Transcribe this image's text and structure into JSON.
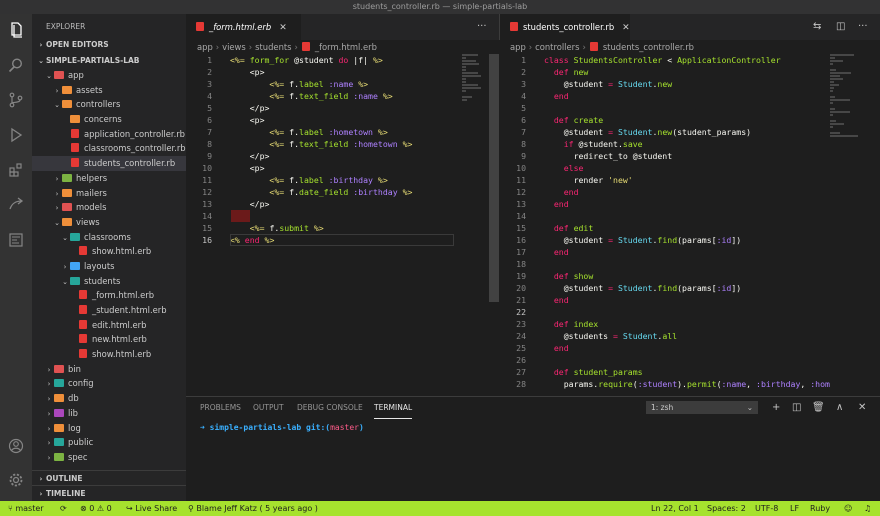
{
  "window": {
    "title": "students_controller.rb — simple-partials-lab"
  },
  "activity_bar": [
    "files-icon",
    "search-icon",
    "source-control-icon",
    "run-debug-icon",
    "extensions-icon",
    "remote-icon",
    "preview-icon",
    "account-icon",
    "settings-gear-icon"
  ],
  "sidebar": {
    "title": "EXPLORER",
    "open_editors": "OPEN EDITORS",
    "project": "SIMPLE-PARTIALS-LAB",
    "tree": [
      {
        "label": "app",
        "depth": 1,
        "type": "folder",
        "color": "red",
        "open": true
      },
      {
        "label": "assets",
        "depth": 2,
        "type": "folder",
        "color": "orange",
        "open": false
      },
      {
        "label": "controllers",
        "depth": 2,
        "type": "folder",
        "color": "orange",
        "open": true
      },
      {
        "label": "concerns",
        "depth": 3,
        "type": "folder",
        "color": "orange",
        "open": false,
        "nochev": true
      },
      {
        "label": "application_controller.rb",
        "depth": 3,
        "type": "file"
      },
      {
        "label": "classrooms_controller.rb",
        "depth": 3,
        "type": "file"
      },
      {
        "label": "students_controller.rb",
        "depth": 3,
        "type": "file",
        "selected": true
      },
      {
        "label": "helpers",
        "depth": 2,
        "type": "folder",
        "color": "green",
        "open": false
      },
      {
        "label": "mailers",
        "depth": 2,
        "type": "folder",
        "color": "orange",
        "open": false
      },
      {
        "label": "models",
        "depth": 2,
        "type": "folder",
        "color": "red",
        "open": false
      },
      {
        "label": "views",
        "depth": 2,
        "type": "folder",
        "color": "orange",
        "open": true
      },
      {
        "label": "classrooms",
        "depth": 3,
        "type": "folder",
        "color": "teal",
        "open": true
      },
      {
        "label": "show.html.erb",
        "depth": 4,
        "type": "file"
      },
      {
        "label": "layouts",
        "depth": 3,
        "type": "folder",
        "color": "blue",
        "open": false
      },
      {
        "label": "students",
        "depth": 3,
        "type": "folder",
        "color": "teal",
        "open": true
      },
      {
        "label": "_form.html.erb",
        "depth": 4,
        "type": "file"
      },
      {
        "label": "_student.html.erb",
        "depth": 4,
        "type": "file"
      },
      {
        "label": "edit.html.erb",
        "depth": 4,
        "type": "file"
      },
      {
        "label": "new.html.erb",
        "depth": 4,
        "type": "file"
      },
      {
        "label": "show.html.erb",
        "depth": 4,
        "type": "file"
      },
      {
        "label": "bin",
        "depth": 1,
        "type": "folder",
        "color": "red",
        "open": false
      },
      {
        "label": "config",
        "depth": 1,
        "type": "folder",
        "color": "teal",
        "open": false
      },
      {
        "label": "db",
        "depth": 1,
        "type": "folder",
        "color": "orange",
        "open": false
      },
      {
        "label": "lib",
        "depth": 1,
        "type": "folder",
        "color": "purple",
        "open": false
      },
      {
        "label": "log",
        "depth": 1,
        "type": "folder",
        "color": "orange",
        "open": false
      },
      {
        "label": "public",
        "depth": 1,
        "type": "folder",
        "color": "teal",
        "open": false
      },
      {
        "label": "spec",
        "depth": 1,
        "type": "folder",
        "color": "green",
        "open": false
      }
    ],
    "outline": "OUTLINE",
    "timeline": "TIMELINE"
  },
  "left_editor": {
    "tab": "_form.html.erb",
    "breadcrumb": [
      "app",
      "views",
      "students",
      "_form.html.erb"
    ],
    "lines": [
      [
        [
          "<%= ",
          "erb"
        ],
        [
          "form_for ",
          "fn"
        ],
        [
          "@student ",
          "id"
        ],
        [
          "do ",
          "kw"
        ],
        [
          "|f| ",
          "id"
        ],
        [
          "%>",
          "erb"
        ]
      ],
      [
        [
          "    <p>",
          "tag"
        ]
      ],
      [
        [
          "        <%= ",
          "erb"
        ],
        [
          "f",
          "id"
        ],
        [
          ".",
          "id"
        ],
        [
          "label ",
          "fn"
        ],
        [
          ":name ",
          "sym"
        ],
        [
          "%>",
          "erb"
        ]
      ],
      [
        [
          "        <%= ",
          "erb"
        ],
        [
          "f",
          "id"
        ],
        [
          ".",
          "id"
        ],
        [
          "text_field ",
          "fn"
        ],
        [
          ":name ",
          "sym"
        ],
        [
          "%>",
          "erb"
        ]
      ],
      [
        [
          "    </p>",
          "tag"
        ]
      ],
      [
        [
          "    <p>",
          "tag"
        ]
      ],
      [
        [
          "        <%= ",
          "erb"
        ],
        [
          "f",
          "id"
        ],
        [
          ".",
          "id"
        ],
        [
          "label ",
          "fn"
        ],
        [
          ":hometown ",
          "sym"
        ],
        [
          "%>",
          "erb"
        ]
      ],
      [
        [
          "        <%= ",
          "erb"
        ],
        [
          "f",
          "id"
        ],
        [
          ".",
          "id"
        ],
        [
          "text_field ",
          "fn"
        ],
        [
          ":hometown ",
          "sym"
        ],
        [
          "%>",
          "erb"
        ]
      ],
      [
        [
          "    </p>",
          "tag"
        ]
      ],
      [
        [
          "    <p>",
          "tag"
        ]
      ],
      [
        [
          "        <%= ",
          "erb"
        ],
        [
          "f",
          "id"
        ],
        [
          ".",
          "id"
        ],
        [
          "label ",
          "fn"
        ],
        [
          ":birthday ",
          "sym"
        ],
        [
          "%>",
          "erb"
        ]
      ],
      [
        [
          "        <%= ",
          "erb"
        ],
        [
          "f",
          "id"
        ],
        [
          ".",
          "id"
        ],
        [
          "date_field ",
          "fn"
        ],
        [
          ":birthday ",
          "sym"
        ],
        [
          "%>",
          "erb"
        ]
      ],
      [
        [
          "    </p>",
          "tag"
        ]
      ],
      [
        [
          "",
          "id"
        ]
      ],
      [
        [
          "    <%= ",
          "erb"
        ],
        [
          "f",
          "id"
        ],
        [
          ".",
          "id"
        ],
        [
          "submit ",
          "fn"
        ],
        [
          "%>",
          "erb"
        ]
      ],
      [
        [
          "<% ",
          "erb"
        ],
        [
          "end ",
          "kw"
        ],
        [
          "%>",
          "erb"
        ]
      ]
    ]
  },
  "right_editor": {
    "tab": "students_controller.rb",
    "breadcrumb": [
      "app",
      "controllers",
      "students_controller.rb"
    ],
    "current_line": 22,
    "lines": [
      [
        [
          "class ",
          "kw"
        ],
        [
          "StudentsController ",
          "cls"
        ],
        [
          "< ",
          "id"
        ],
        [
          "ApplicationController",
          "cls"
        ]
      ],
      [
        [
          "  def ",
          "def"
        ],
        [
          "new",
          "dm"
        ]
      ],
      [
        [
          "    @student ",
          "iv"
        ],
        [
          "= ",
          "kw"
        ],
        [
          "Student",
          "const"
        ],
        [
          ".",
          "id"
        ],
        [
          "new",
          "dm"
        ]
      ],
      [
        [
          "  end",
          "def"
        ]
      ],
      [
        [
          "",
          "id"
        ]
      ],
      [
        [
          "  def ",
          "def"
        ],
        [
          "create",
          "dm"
        ]
      ],
      [
        [
          "    @student ",
          "iv"
        ],
        [
          "= ",
          "kw"
        ],
        [
          "Student",
          "const"
        ],
        [
          ".",
          "id"
        ],
        [
          "new",
          "dm"
        ],
        [
          "(student_params)",
          "id"
        ]
      ],
      [
        [
          "    if ",
          "kw"
        ],
        [
          "@student",
          "iv"
        ],
        [
          ".",
          "id"
        ],
        [
          "save",
          "dm"
        ]
      ],
      [
        [
          "      redirect_to ",
          "id"
        ],
        [
          "@student",
          "iv"
        ]
      ],
      [
        [
          "    else",
          "kw"
        ]
      ],
      [
        [
          "      render ",
          "id"
        ],
        [
          "'new'",
          "str"
        ]
      ],
      [
        [
          "    end",
          "kw"
        ]
      ],
      [
        [
          "  end",
          "def"
        ]
      ],
      [
        [
          "",
          "id"
        ]
      ],
      [
        [
          "  def ",
          "def"
        ],
        [
          "edit",
          "dm"
        ]
      ],
      [
        [
          "    @student ",
          "iv"
        ],
        [
          "= ",
          "kw"
        ],
        [
          "Student",
          "const"
        ],
        [
          ".",
          "id"
        ],
        [
          "find",
          "dm"
        ],
        [
          "(params[",
          "id"
        ],
        [
          ":id",
          "sym"
        ],
        [
          "])",
          "id"
        ]
      ],
      [
        [
          "  end",
          "def"
        ]
      ],
      [
        [
          "",
          "id"
        ]
      ],
      [
        [
          "  def ",
          "def"
        ],
        [
          "show",
          "dm"
        ]
      ],
      [
        [
          "    @student ",
          "iv"
        ],
        [
          "= ",
          "kw"
        ],
        [
          "Student",
          "const"
        ],
        [
          ".",
          "id"
        ],
        [
          "find",
          "dm"
        ],
        [
          "(params[",
          "id"
        ],
        [
          ":id",
          "sym"
        ],
        [
          "])",
          "id"
        ]
      ],
      [
        [
          "  end",
          "def"
        ]
      ],
      [
        [
          "",
          "id"
        ]
      ],
      [
        [
          "  def ",
          "def"
        ],
        [
          "index",
          "dm"
        ]
      ],
      [
        [
          "    @students ",
          "iv"
        ],
        [
          "= ",
          "kw"
        ],
        [
          "Student",
          "const"
        ],
        [
          ".",
          "id"
        ],
        [
          "all",
          "dm"
        ]
      ],
      [
        [
          "  end",
          "def"
        ]
      ],
      [
        [
          "",
          "id"
        ]
      ],
      [
        [
          "  def ",
          "def"
        ],
        [
          "student_params",
          "dm"
        ]
      ],
      [
        [
          "    params",
          "id"
        ],
        [
          ".",
          "id"
        ],
        [
          "require",
          "dm"
        ],
        [
          "(",
          "id"
        ],
        [
          ":student",
          "sym"
        ],
        [
          ").",
          "id"
        ],
        [
          "permit",
          "dm"
        ],
        [
          "(",
          "id"
        ],
        [
          ":name",
          "sym"
        ],
        [
          ", ",
          "id"
        ],
        [
          ":birthday",
          "sym"
        ],
        [
          ", ",
          "id"
        ],
        [
          ":hom",
          "sym"
        ]
      ]
    ]
  },
  "panel": {
    "tabs": [
      "PROBLEMS",
      "OUTPUT",
      "DEBUG CONSOLE",
      "TERMINAL"
    ],
    "active_tab": "TERMINAL",
    "terminal_select": "1: zsh",
    "prompt": {
      "arrow": "➜",
      "dir": "simple-partials-lab",
      "git": "git:(",
      "branch": "master",
      "git_close": ")"
    }
  },
  "status_bar": {
    "branch": "master",
    "errors": "0",
    "warnings": "0",
    "live_share": "Live Share",
    "blame": "Blame Jeff Katz ( 5 years ago )",
    "cursor": "Ln 22, Col 1",
    "spaces": "Spaces: 2",
    "encoding": "UTF-8",
    "eol": "LF",
    "language": "Ruby"
  },
  "colors": {
    "status_bar": "#a6e22e",
    "accent": "#a6e22e"
  }
}
